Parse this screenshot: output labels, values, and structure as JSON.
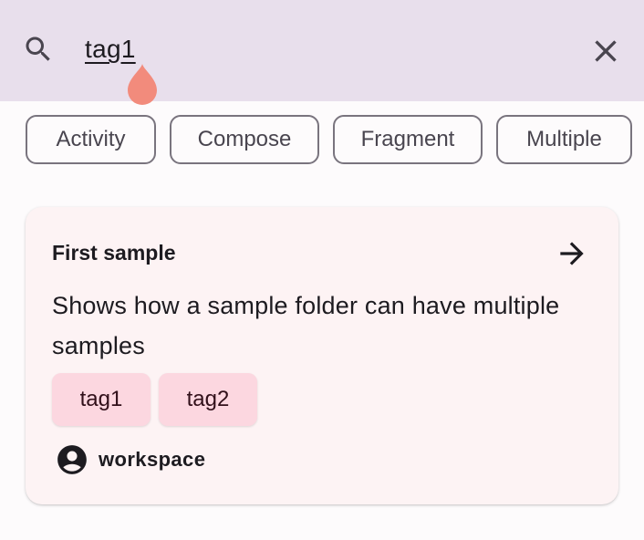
{
  "search": {
    "query": "tag1",
    "search_icon": "search-icon",
    "clear_icon": "close-icon"
  },
  "filters": [
    {
      "label": "Activity"
    },
    {
      "label": "Compose"
    },
    {
      "label": "Fragment"
    },
    {
      "label": "Multiple"
    }
  ],
  "card": {
    "title": "First sample",
    "action_icon": "arrow-forward-icon",
    "description": "Shows how a sample folder can have multiple samples",
    "tags": [
      {
        "label": "tag1"
      },
      {
        "label": "tag2"
      }
    ],
    "owner_icon": "account-circle-icon",
    "owner": "workspace"
  },
  "colors": {
    "search_bar_bg": "#e8dfec",
    "card_bg": "#fdf3f4",
    "tag_bg": "#fcd7e0",
    "cursor_handle": "#f28b7c",
    "chip_border": "#79747e"
  }
}
